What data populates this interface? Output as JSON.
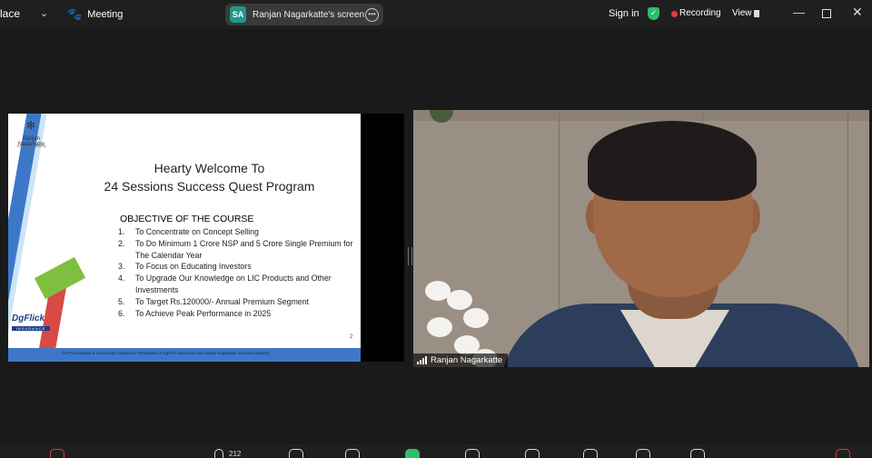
{
  "topbar": {
    "app_name": "lace",
    "meeting_label": "Meeting",
    "screen_share": {
      "avatar_initials": "SA",
      "label": "Ranjan Nagarkatte's screen"
    },
    "sign_in": "Sign in",
    "recording_label": "Recording",
    "view_label": "View"
  },
  "slide": {
    "brand_name": "Ranjan Nagarkatte",
    "brand_sub": "Success Academy",
    "partner_logo_main": "DgFlick",
    "partner_logo_sub": "INSURANCE",
    "title_line1": "Hearty Welcome To",
    "title_line2": "24 Sessions Success Quest  Program",
    "objective_heading": "OBJECTIVE OF THE COURSE",
    "objectives": [
      {
        "num": "1.",
        "text": "To Concentrate on Concept Selling"
      },
      {
        "num": "2.",
        "text": "To Do Minimum 1 Crore NSP and 5 Crore Single Premium for The Calendar Year"
      },
      {
        "num": "3.",
        "text": "To Focus on Educating Investors"
      },
      {
        "num": "4.",
        "text": "To Upgrade Our Knowledge on LIC Products and Other Investments"
      },
      {
        "num": "5.",
        "text": "To Target Rs.120000/- Annual Premium Segment"
      },
      {
        "num": "6.",
        "text": "To Achieve Peak Performance in 2025"
      }
    ],
    "page_number": "2",
    "footer_text": "This Presentation is Exclusively Created for Participants of DgFlick Assurance and Ranjan Nagarkatte Success Academy"
  },
  "video": {
    "participant_name": "Ranjan Nagarkatte"
  },
  "bottombar": {
    "participant_count": "212"
  },
  "colors": {
    "accent_green": "#2ebd6b",
    "record_red": "#e53935",
    "slide_blue": "#3d78c8",
    "slide_green": "#7fbf3f",
    "slide_red": "#d94a44"
  }
}
